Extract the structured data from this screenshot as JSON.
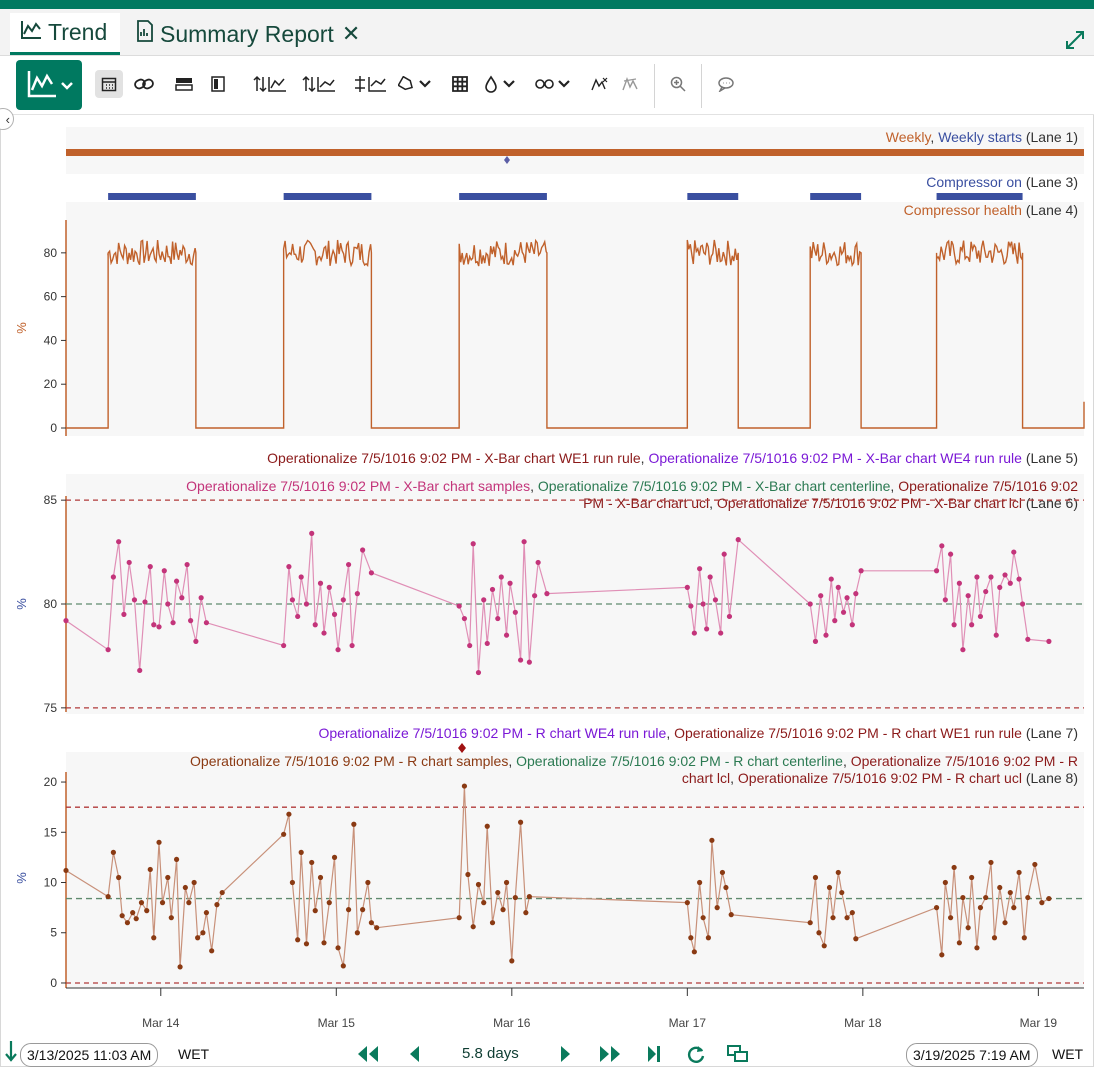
{
  "tabs": [
    {
      "label": "Trend",
      "icon": "trend-chart-icon"
    },
    {
      "label": "Summary Report",
      "icon": "report-document-icon"
    }
  ],
  "toolbar": {
    "icons": [
      "chart-type-icon",
      "calendar-icon",
      "link-icon",
      "layout-icon",
      "capsule-icon",
      "lanes-icon",
      "axis-icon",
      "align-icon",
      "label-icon",
      "grid-icon",
      "color-icon",
      "custom-icon",
      "dashboard-icon",
      "pin-icon",
      "zoom-icon",
      "comment-icon"
    ]
  },
  "colors": {
    "brand": "#007960",
    "orange": "#c0612b",
    "blue": "#3a4fa0",
    "maroon": "#8b1a1a",
    "purple": "#7a18d6",
    "pink": "#c3347a",
    "green": "#2b7a52",
    "brown": "#8a3a13"
  },
  "lanes": {
    "lane1": {
      "parts": [
        "Weekly",
        ", ",
        "Weekly starts",
        " (Lane 1)"
      ]
    },
    "lane3": {
      "parts": [
        "Compressor on",
        " (Lane 3)"
      ]
    },
    "lane4": {
      "parts": [
        "Compressor health",
        " (Lane 4)"
      ],
      "unit": "%"
    },
    "lane5": {
      "parts": [
        "Operationalize 7/5/1016 9:02 PM - X-Bar chart WE1 run rule",
        ", ",
        "Operationalize 7/5/1016 9:02 PM - X-Bar chart WE4 run rule",
        " (Lane 5)"
      ]
    },
    "lane6": {
      "line1": [
        "Operationalize 7/5/1016 9:02 PM - X-Bar chart samples",
        ", ",
        "Operationalize 7/5/1016 9:02 PM - X-Bar chart centerline",
        ", ",
        "Operationalize 7/5/1016 9:02"
      ],
      "line2": [
        "PM - X-Bar chart ucl",
        ", ",
        "Operationalize 7/5/1016 9:02 PM - X-Bar chart lcl",
        " (Lane 6)"
      ],
      "unit": "%"
    },
    "lane7": {
      "parts": [
        "Operationalize 7/5/1016 9:02 PM - R chart WE4 run rule",
        ", ",
        "Operationalize 7/5/1016 9:02 PM - R chart WE1 run rule",
        " (Lane 7)"
      ]
    },
    "lane8": {
      "line1": [
        "Operationalize 7/5/1016 9:02 PM - R chart samples",
        ", ",
        "Operationalize 7/5/1016 9:02 PM - R chart centerline",
        ", ",
        "Operationalize 7/5/1016 9:02 PM - R"
      ],
      "line2": [
        "chart lcl",
        ", ",
        "Operationalize 7/5/1016 9:02 PM - R chart ucl",
        " (Lane 8)"
      ],
      "unit": "%"
    }
  },
  "chart_data": [
    {
      "type": "line",
      "name": "Compressor health",
      "ylabel": "%",
      "yticks": [
        0,
        20,
        40,
        60,
        80
      ],
      "ylim": [
        0,
        95
      ],
      "xlim": [
        0,
        5.8
      ],
      "on_periods": [
        [
          0.24,
          0.74
        ],
        [
          1.24,
          1.74
        ],
        [
          2.24,
          2.74
        ],
        [
          3.54,
          3.83
        ],
        [
          4.24,
          4.53
        ],
        [
          4.96,
          5.45
        ]
      ],
      "on_level": 80,
      "off_level": 0
    },
    {
      "type": "line",
      "name": "X-Bar chart",
      "ylabel": "%",
      "yticks": [
        75,
        80,
        85
      ],
      "ylim": [
        74.8,
        85.2
      ],
      "ucl": 85,
      "centerline": 80,
      "lcl": 75,
      "samples": [
        [
          0.0,
          79.2
        ],
        [
          0.24,
          77.8
        ],
        [
          0.27,
          81.3
        ],
        [
          0.3,
          83.0
        ],
        [
          0.33,
          79.5
        ],
        [
          0.36,
          82.0
        ],
        [
          0.39,
          80.2
        ],
        [
          0.42,
          76.8
        ],
        [
          0.45,
          80.1
        ],
        [
          0.48,
          81.8
        ],
        [
          0.5,
          79.0
        ],
        [
          0.53,
          78.9
        ],
        [
          0.56,
          81.6
        ],
        [
          0.58,
          80.0
        ],
        [
          0.61,
          79.1
        ],
        [
          0.63,
          81.1
        ],
        [
          0.66,
          80.3
        ],
        [
          0.69,
          81.9
        ],
        [
          0.71,
          79.2
        ],
        [
          0.74,
          78.2
        ],
        [
          0.77,
          80.3
        ],
        [
          0.8,
          79.1
        ],
        [
          1.24,
          78.0
        ],
        [
          1.27,
          81.8
        ],
        [
          1.29,
          80.2
        ],
        [
          1.32,
          79.4
        ],
        [
          1.34,
          81.3
        ],
        [
          1.37,
          80.0
        ],
        [
          1.4,
          83.4
        ],
        [
          1.42,
          79.0
        ],
        [
          1.45,
          81.0
        ],
        [
          1.47,
          78.6
        ],
        [
          1.5,
          80.8
        ],
        [
          1.53,
          79.5
        ],
        [
          1.55,
          77.8
        ],
        [
          1.58,
          80.2
        ],
        [
          1.61,
          81.9
        ],
        [
          1.63,
          78.0
        ],
        [
          1.66,
          80.5
        ],
        [
          1.69,
          82.6
        ],
        [
          1.74,
          81.5
        ],
        [
          2.24,
          79.9
        ],
        [
          2.27,
          79.3
        ],
        [
          2.3,
          78.0
        ],
        [
          2.32,
          82.9
        ],
        [
          2.35,
          76.7
        ],
        [
          2.38,
          80.2
        ],
        [
          2.4,
          78.1
        ],
        [
          2.43,
          80.7
        ],
        [
          2.46,
          79.3
        ],
        [
          2.48,
          81.3
        ],
        [
          2.51,
          78.5
        ],
        [
          2.53,
          81.0
        ],
        [
          2.56,
          79.6
        ],
        [
          2.59,
          77.3
        ],
        [
          2.61,
          83.0
        ],
        [
          2.64,
          77.2
        ],
        [
          2.67,
          80.4
        ],
        [
          2.69,
          82.0
        ],
        [
          2.74,
          80.5
        ],
        [
          3.54,
          80.8
        ],
        [
          3.56,
          79.9
        ],
        [
          3.58,
          78.6
        ],
        [
          3.61,
          81.7
        ],
        [
          3.63,
          80.0
        ],
        [
          3.65,
          78.8
        ],
        [
          3.67,
          81.3
        ],
        [
          3.7,
          80.2
        ],
        [
          3.73,
          78.6
        ],
        [
          3.75,
          82.4
        ],
        [
          3.78,
          79.4
        ],
        [
          3.83,
          83.1
        ],
        [
          4.24,
          80.0
        ],
        [
          4.27,
          78.2
        ],
        [
          4.3,
          80.4
        ],
        [
          4.33,
          78.5
        ],
        [
          4.36,
          81.2
        ],
        [
          4.38,
          79.2
        ],
        [
          4.4,
          80.8
        ],
        [
          4.43,
          79.6
        ],
        [
          4.45,
          80.3
        ],
        [
          4.48,
          79.0
        ],
        [
          4.5,
          80.5
        ],
        [
          4.53,
          81.6
        ],
        [
          4.96,
          81.6
        ],
        [
          4.99,
          82.8
        ],
        [
          5.01,
          80.2
        ],
        [
          5.04,
          82.4
        ],
        [
          5.06,
          79.0
        ],
        [
          5.09,
          81.0
        ],
        [
          5.11,
          77.8
        ],
        [
          5.14,
          80.4
        ],
        [
          5.16,
          79.0
        ],
        [
          5.19,
          81.3
        ],
        [
          5.21,
          79.4
        ],
        [
          5.24,
          80.6
        ],
        [
          5.27,
          81.3
        ],
        [
          5.3,
          78.5
        ],
        [
          5.32,
          80.8
        ],
        [
          5.35,
          81.4
        ],
        [
          5.38,
          81.0
        ],
        [
          5.4,
          82.5
        ],
        [
          5.43,
          81.2
        ],
        [
          5.45,
          80.0
        ],
        [
          5.48,
          78.3
        ],
        [
          5.6,
          78.2
        ]
      ]
    },
    {
      "type": "line",
      "name": "R chart",
      "ylabel": "%",
      "yticks": [
        0,
        5,
        10,
        15,
        20
      ],
      "ylim": [
        -0.5,
        21
      ],
      "ucl": 17.5,
      "centerline": 8.4,
      "lcl": 0,
      "samples": [
        [
          0.0,
          11.2
        ],
        [
          0.24,
          8.6
        ],
        [
          0.27,
          13.0
        ],
        [
          0.3,
          10.5
        ],
        [
          0.32,
          6.7
        ],
        [
          0.35,
          6.0
        ],
        [
          0.38,
          7.0
        ],
        [
          0.4,
          6.4
        ],
        [
          0.43,
          8.0
        ],
        [
          0.46,
          7.2
        ],
        [
          0.48,
          11.3
        ],
        [
          0.5,
          4.5
        ],
        [
          0.53,
          14.0
        ],
        [
          0.55,
          8.0
        ],
        [
          0.58,
          10.5
        ],
        [
          0.6,
          6.5
        ],
        [
          0.63,
          12.3
        ],
        [
          0.65,
          1.6
        ],
        [
          0.68,
          9.5
        ],
        [
          0.7,
          8.0
        ],
        [
          0.73,
          10.0
        ],
        [
          0.75,
          4.5
        ],
        [
          0.78,
          5.0
        ],
        [
          0.8,
          7.0
        ],
        [
          0.83,
          3.2
        ],
        [
          0.86,
          7.8
        ],
        [
          0.89,
          9.0
        ],
        [
          1.24,
          14.8
        ],
        [
          1.27,
          16.8
        ],
        [
          1.29,
          10.0
        ],
        [
          1.32,
          4.3
        ],
        [
          1.34,
          13.0
        ],
        [
          1.37,
          3.9
        ],
        [
          1.4,
          12.0
        ],
        [
          1.42,
          7.2
        ],
        [
          1.45,
          10.5
        ],
        [
          1.47,
          4.0
        ],
        [
          1.5,
          8.0
        ],
        [
          1.53,
          12.5
        ],
        [
          1.55,
          3.5
        ],
        [
          1.58,
          1.7
        ],
        [
          1.61,
          7.3
        ],
        [
          1.64,
          15.8
        ],
        [
          1.66,
          5.0
        ],
        [
          1.69,
          7.3
        ],
        [
          1.72,
          10.0
        ],
        [
          1.74,
          6.0
        ],
        [
          1.77,
          5.5
        ],
        [
          2.24,
          6.5
        ],
        [
          2.27,
          19.6
        ],
        [
          2.29,
          10.8
        ],
        [
          2.32,
          5.6
        ],
        [
          2.35,
          9.8
        ],
        [
          2.38,
          8.0
        ],
        [
          2.4,
          15.6
        ],
        [
          2.43,
          6.0
        ],
        [
          2.46,
          9.0
        ],
        [
          2.49,
          7.3
        ],
        [
          2.51,
          10.0
        ],
        [
          2.54,
          2.2
        ],
        [
          2.56,
          8.5
        ],
        [
          2.59,
          16.0
        ],
        [
          2.62,
          7.0
        ],
        [
          2.64,
          8.6
        ],
        [
          3.54,
          8.0
        ],
        [
          3.56,
          4.5
        ],
        [
          3.58,
          3.1
        ],
        [
          3.61,
          10.0
        ],
        [
          3.63,
          6.5
        ],
        [
          3.66,
          4.5
        ],
        [
          3.68,
          14.2
        ],
        [
          3.71,
          7.5
        ],
        [
          3.74,
          11.0
        ],
        [
          3.76,
          9.5
        ],
        [
          3.79,
          6.8
        ],
        [
          4.24,
          6.0
        ],
        [
          4.27,
          10.5
        ],
        [
          4.29,
          5.0
        ],
        [
          4.32,
          3.7
        ],
        [
          4.35,
          9.5
        ],
        [
          4.37,
          6.5
        ],
        [
          4.4,
          11.0
        ],
        [
          4.42,
          9.0
        ],
        [
          4.45,
          6.5
        ],
        [
          4.48,
          7.0
        ],
        [
          4.5,
          4.4
        ],
        [
          4.96,
          7.5
        ],
        [
          4.99,
          2.8
        ],
        [
          5.01,
          10.0
        ],
        [
          5.04,
          6.5
        ],
        [
          5.06,
          11.5
        ],
        [
          5.09,
          4.0
        ],
        [
          5.11,
          8.5
        ],
        [
          5.14,
          5.5
        ],
        [
          5.16,
          10.5
        ],
        [
          5.19,
          3.5
        ],
        [
          5.21,
          7.5
        ],
        [
          5.24,
          8.5
        ],
        [
          5.27,
          12.0
        ],
        [
          5.29,
          4.5
        ],
        [
          5.32,
          9.5
        ],
        [
          5.35,
          6.0
        ],
        [
          5.38,
          9.0
        ],
        [
          5.4,
          7.5
        ],
        [
          5.43,
          11.0
        ],
        [
          5.46,
          4.5
        ],
        [
          5.48,
          8.5
        ],
        [
          5.52,
          11.8
        ],
        [
          5.56,
          8.0
        ],
        [
          5.6,
          8.4
        ]
      ]
    }
  ],
  "xaxis": {
    "ticks": [
      {
        "label": "Mar 14",
        "x": 0.54
      },
      {
        "label": "Mar 15",
        "x": 1.54
      },
      {
        "label": "Mar 16",
        "x": 2.54
      },
      {
        "label": "Mar 17",
        "x": 3.54
      },
      {
        "label": "Mar 18",
        "x": 4.54
      },
      {
        "label": "Mar 19",
        "x": 5.54
      }
    ]
  },
  "footer": {
    "start": "3/13/2025 11:03 AM",
    "end": "3/19/2025 7:19 AM",
    "timezone": "WET",
    "duration": "5.8 days"
  }
}
